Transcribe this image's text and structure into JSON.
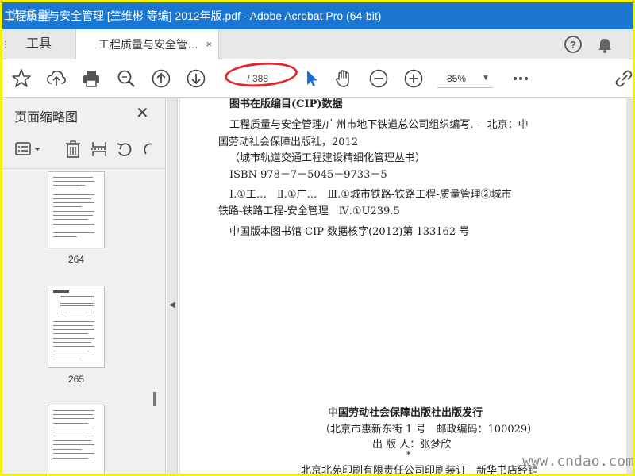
{
  "window": {
    "title": "工程质量与安全管理 [竺维彬 等编] 2012年版.pdf - Adobe Acrobat Pro (64-bit)",
    "title_bg": "#1b76d1",
    "watermark_tl": "选择器"
  },
  "tabs": {
    "tools_label": "工具",
    "doc_label": "工程质量与安全管…",
    "close": "×"
  },
  "toolbar": {
    "page_current": "",
    "page_total": "/ 388",
    "zoom": "85%",
    "icons": [
      "star-icon",
      "upload-icon",
      "print-icon",
      "search-icon",
      "page-up-icon",
      "page-down-icon",
      "select-cursor-icon",
      "hand-icon",
      "zoom-out-icon",
      "zoom-in-icon",
      "more-icon",
      "link-icon"
    ],
    "highlight_color": "#e4262a"
  },
  "sidebar": {
    "title": "页面缩略图",
    "thumbnails": [
      {
        "label": "264"
      },
      {
        "label": "265"
      },
      {
        "label": ""
      }
    ]
  },
  "document": {
    "cip_heading": "图书在版编目(CIP)数据",
    "lines": [
      "工程质量与安全管理/广州市地下铁道总公司组织编写. —北京：中",
      "国劳动社会保障出版社，2012",
      "（城市轨道交通工程建设精细化管理丛书）",
      "ISBN 978－7－5045－9733－5",
      "Ⅰ.①工…　Ⅱ.①广…　Ⅲ.①城市铁路-铁路工程-质量管理②城市",
      "铁路-铁路工程-安全管理　Ⅳ.①U239.5",
      "中国版本图书馆 CIP 数据核字(2012)第 133162 号"
    ],
    "publisher": "中国劳动社会保障出版社出版发行",
    "address": "（北京市惠新东街 1 号　邮政编码：100029）",
    "publisher_person": "出 版 人：张梦欣",
    "star": "*",
    "printer": "北京北苑印刷有限责任公司印刷装订　新华书店经销"
  },
  "watermark_br": "www.cndao.com"
}
